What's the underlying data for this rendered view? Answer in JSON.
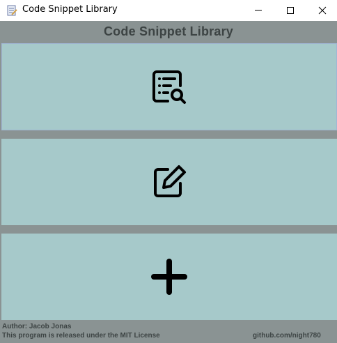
{
  "window": {
    "title": "Code Snippet Library",
    "controls": {
      "minimize_icon": "minimize-icon",
      "maximize_icon": "maximize-icon",
      "close_icon": "close-icon"
    }
  },
  "header": {
    "title": "Code Snippet Library"
  },
  "actions": [
    {
      "icon": "search-list-icon"
    },
    {
      "icon": "edit-icon"
    },
    {
      "icon": "plus-icon"
    }
  ],
  "footer": {
    "author": "Author: Jacob Jonas",
    "license": "This program is released under the MIT License",
    "link": "github.com/night780"
  },
  "colors": {
    "panel_background": "#a6c9ca",
    "frame_background": "#8a9393",
    "header_text": "#3d4444",
    "icon_stroke": "#000000"
  }
}
